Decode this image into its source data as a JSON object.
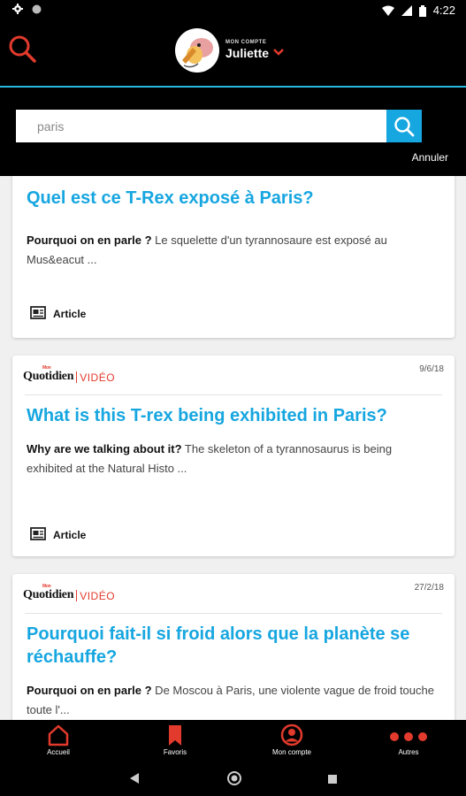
{
  "status_bar": {
    "time": "4:22"
  },
  "header": {
    "account_label": "MON COMPTE",
    "account_name": "Juliette"
  },
  "search": {
    "value": "paris",
    "cancel_label": "Annuler"
  },
  "results": [
    {
      "title": "Quel est ce T-Rex exposé à Paris?",
      "desc_bold": "Pourquoi on en parle ?",
      "desc_text": " Le squelette d'un tyrannosaure est exposé au Mus&eacut ...",
      "type": "Article"
    },
    {
      "brand": "Quotidien",
      "brand_small": "Mon",
      "section": "VIDÉO",
      "date": "9/6/18",
      "title": "What is this T-rex being exhibited in Paris?",
      "desc_bold": "Why are we talking about it?",
      "desc_text": " The skeleton of a tyrannosaurus is being exhibited at the Natural Histo ...",
      "type": "Article"
    },
    {
      "brand": "Quotidien",
      "brand_small": "Mon",
      "section": "VIDÉO",
      "date": "27/2/18",
      "title": "Pourquoi fait-il si froid alors que la planète se réchauffe?",
      "desc_bold": "Pourquoi on en parle ?",
      "desc_text": " De Moscou à Paris, une violente vague de froid touche toute l'..."
    }
  ],
  "bottom_nav": [
    {
      "label": "Accueil",
      "icon": "home-icon"
    },
    {
      "label": "Favoris",
      "icon": "bookmark-icon"
    },
    {
      "label": "Mon compte",
      "icon": "user-icon"
    },
    {
      "label": "Autres",
      "icon": "more-dots-icon"
    }
  ],
  "colors": {
    "accent_blue": "#16a6e0",
    "accent_red": "#e23a2c",
    "header_bg": "#000000"
  }
}
